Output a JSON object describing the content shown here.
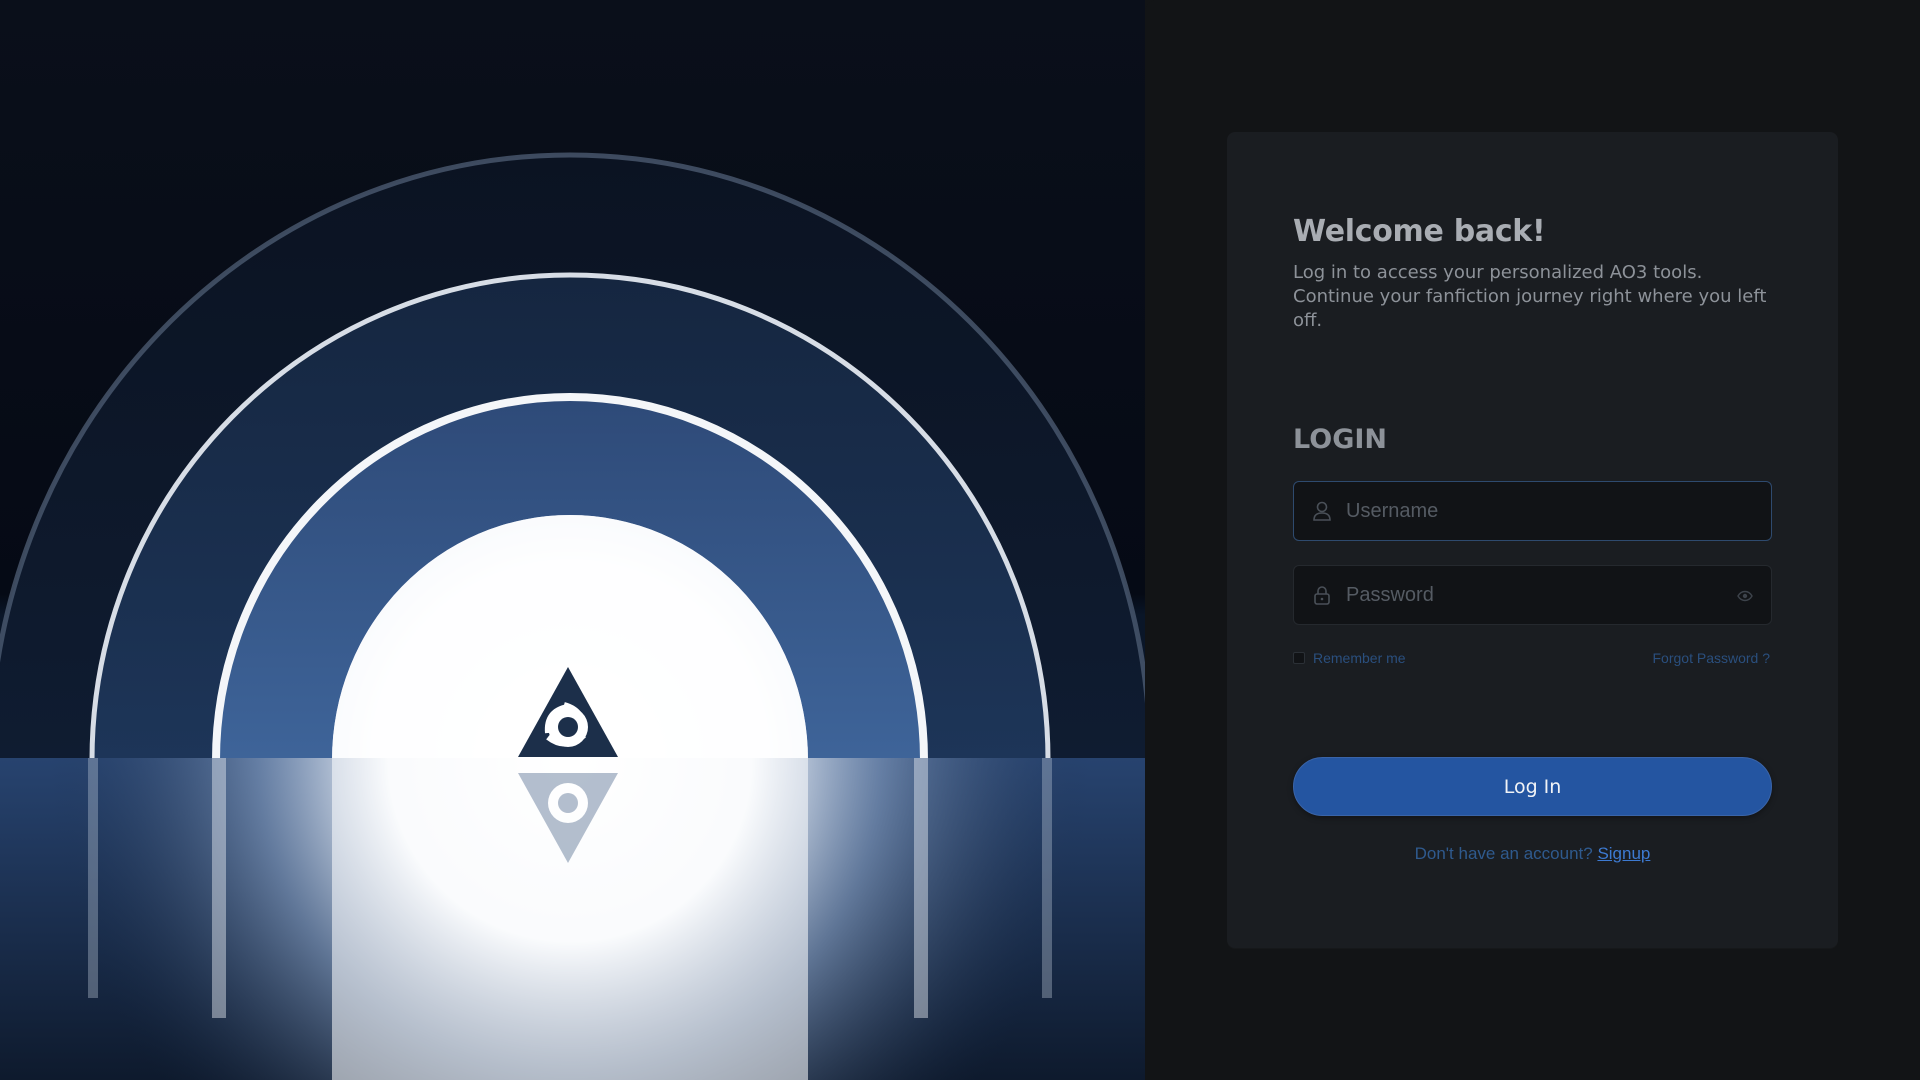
{
  "login": {
    "welcome_title": "Welcome back!",
    "welcome_subtitle": "Log in to access your personalized AO3 tools. Continue your fanfiction journey right where you left off.",
    "heading": "LOGIN",
    "username_placeholder": "Username",
    "password_placeholder": "Password",
    "remember_label": "Remember me",
    "forgot_label": "Forgot Password ?",
    "submit_label": "Log In",
    "signup_prompt": "Don't have an account?",
    "signup_link": "Signup"
  },
  "icons": {
    "logo": "triskelion-triangle-logo",
    "username": "user-icon",
    "password": "lock-icon",
    "toggle_password": "eye-icon"
  },
  "colors": {
    "accent": "#2455a1",
    "link": "#3d7ad1",
    "panel_bg": "#121416",
    "card_bg": "#1a1d21"
  }
}
